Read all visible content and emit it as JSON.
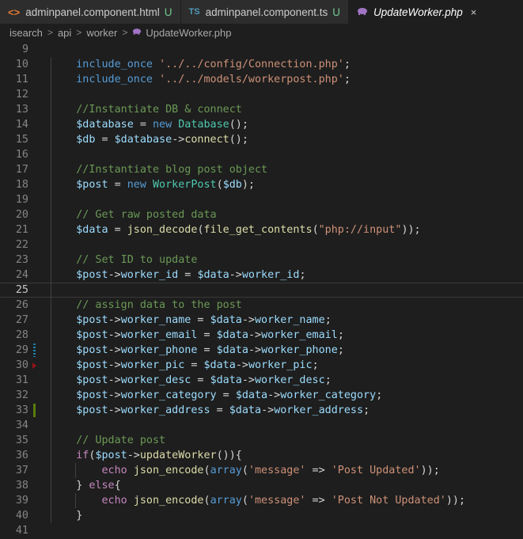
{
  "tabs": [
    {
      "icon": "<>",
      "label": "adminpanel.component.html",
      "badge": "U",
      "active": false
    },
    {
      "icon": "TS",
      "label": "adminpanel.component.ts",
      "badge": "U",
      "active": false
    },
    {
      "icon": "php",
      "label": "UpdateWorker.php",
      "close": "×",
      "active": true
    }
  ],
  "breadcrumb": {
    "items": [
      "isearch",
      "api",
      "worker",
      "UpdateWorker.php"
    ],
    "separator": ">"
  },
  "editor": {
    "current_line": 25,
    "lines": [
      {
        "n": "9",
        "tokens": []
      },
      {
        "n": "10",
        "tokens": [
          [
            "kw",
            "include_once"
          ],
          [
            "op",
            " "
          ],
          [
            "str",
            "'../../config/Connection.php'"
          ],
          [
            "op",
            ";"
          ]
        ]
      },
      {
        "n": "11",
        "tokens": [
          [
            "kw",
            "include_once"
          ],
          [
            "op",
            " "
          ],
          [
            "str",
            "'../../models/workerpost.php'"
          ],
          [
            "op",
            ";"
          ]
        ]
      },
      {
        "n": "12",
        "tokens": []
      },
      {
        "n": "13",
        "tokens": [
          [
            "cm",
            "//Instantiate DB & connect"
          ]
        ]
      },
      {
        "n": "14",
        "tokens": [
          [
            "var",
            "$database"
          ],
          [
            "op",
            " = "
          ],
          [
            "kw",
            "new"
          ],
          [
            "op",
            " "
          ],
          [
            "cls",
            "Database"
          ],
          [
            "op",
            "();"
          ]
        ]
      },
      {
        "n": "15",
        "tokens": [
          [
            "var",
            "$db"
          ],
          [
            "op",
            " = "
          ],
          [
            "var",
            "$database"
          ],
          [
            "op",
            "->"
          ],
          [
            "fn",
            "connect"
          ],
          [
            "op",
            "();"
          ]
        ]
      },
      {
        "n": "16",
        "tokens": []
      },
      {
        "n": "17",
        "tokens": [
          [
            "cm",
            "//Instantiate blog post object"
          ]
        ]
      },
      {
        "n": "18",
        "tokens": [
          [
            "var",
            "$post"
          ],
          [
            "op",
            " = "
          ],
          [
            "kw",
            "new"
          ],
          [
            "op",
            " "
          ],
          [
            "cls",
            "WorkerPost"
          ],
          [
            "op",
            "("
          ],
          [
            "var",
            "$db"
          ],
          [
            "op",
            ");"
          ]
        ]
      },
      {
        "n": "19",
        "tokens": []
      },
      {
        "n": "20",
        "tokens": [
          [
            "cm",
            "// Get raw posted data"
          ]
        ]
      },
      {
        "n": "21",
        "tokens": [
          [
            "var",
            "$data"
          ],
          [
            "op",
            " = "
          ],
          [
            "fn",
            "json_decode"
          ],
          [
            "op",
            "("
          ],
          [
            "fn",
            "file_get_contents"
          ],
          [
            "op",
            "("
          ],
          [
            "str",
            "\"php://input\""
          ],
          [
            "op",
            "));"
          ]
        ]
      },
      {
        "n": "22",
        "tokens": []
      },
      {
        "n": "23",
        "tokens": [
          [
            "cm",
            "// Set ID to update"
          ]
        ]
      },
      {
        "n": "24",
        "tokens": [
          [
            "var",
            "$post"
          ],
          [
            "op",
            "->"
          ],
          [
            "var",
            "worker_id"
          ],
          [
            "op",
            " = "
          ],
          [
            "var",
            "$data"
          ],
          [
            "op",
            "->"
          ],
          [
            "var",
            "worker_id"
          ],
          [
            "op",
            ";"
          ]
        ]
      },
      {
        "n": "25",
        "tokens": []
      },
      {
        "n": "26",
        "tokens": [
          [
            "cm",
            "// assign data to the post"
          ]
        ]
      },
      {
        "n": "27",
        "tokens": [
          [
            "var",
            "$post"
          ],
          [
            "op",
            "->"
          ],
          [
            "var",
            "worker_name"
          ],
          [
            "op",
            " = "
          ],
          [
            "var",
            "$data"
          ],
          [
            "op",
            "->"
          ],
          [
            "var",
            "worker_name"
          ],
          [
            "op",
            ";"
          ]
        ]
      },
      {
        "n": "28",
        "tokens": [
          [
            "var",
            "$post"
          ],
          [
            "op",
            "->"
          ],
          [
            "var",
            "worker_email"
          ],
          [
            "op",
            " = "
          ],
          [
            "var",
            "$data"
          ],
          [
            "op",
            "->"
          ],
          [
            "var",
            "worker_email"
          ],
          [
            "op",
            ";"
          ]
        ]
      },
      {
        "n": "29",
        "tokens": [
          [
            "var",
            "$post"
          ],
          [
            "op",
            "->"
          ],
          [
            "var",
            "worker_phone"
          ],
          [
            "op",
            " = "
          ],
          [
            "var",
            "$data"
          ],
          [
            "op",
            "->"
          ],
          [
            "var",
            "worker_phone"
          ],
          [
            "op",
            ";"
          ]
        ]
      },
      {
        "n": "30",
        "tokens": [
          [
            "var",
            "$post"
          ],
          [
            "op",
            "->"
          ],
          [
            "var",
            "worker_pic"
          ],
          [
            "op",
            " = "
          ],
          [
            "var",
            "$data"
          ],
          [
            "op",
            "->"
          ],
          [
            "var",
            "worker_pic"
          ],
          [
            "op",
            ";"
          ]
        ]
      },
      {
        "n": "31",
        "tokens": [
          [
            "var",
            "$post"
          ],
          [
            "op",
            "->"
          ],
          [
            "var",
            "worker_desc"
          ],
          [
            "op",
            " = "
          ],
          [
            "var",
            "$data"
          ],
          [
            "op",
            "->"
          ],
          [
            "var",
            "worker_desc"
          ],
          [
            "op",
            ";"
          ]
        ]
      },
      {
        "n": "32",
        "tokens": [
          [
            "var",
            "$post"
          ],
          [
            "op",
            "->"
          ],
          [
            "var",
            "worker_category"
          ],
          [
            "op",
            " = "
          ],
          [
            "var",
            "$data"
          ],
          [
            "op",
            "->"
          ],
          [
            "var",
            "worker_category"
          ],
          [
            "op",
            ";"
          ]
        ]
      },
      {
        "n": "33",
        "tokens": [
          [
            "var",
            "$post"
          ],
          [
            "op",
            "->"
          ],
          [
            "var",
            "worker_address"
          ],
          [
            "op",
            " = "
          ],
          [
            "var",
            "$data"
          ],
          [
            "op",
            "->"
          ],
          [
            "var",
            "worker_address"
          ],
          [
            "op",
            ";"
          ]
        ]
      },
      {
        "n": "34",
        "tokens": []
      },
      {
        "n": "35",
        "tokens": [
          [
            "cm",
            "// Update post"
          ]
        ]
      },
      {
        "n": "36",
        "tokens": [
          [
            "ctl",
            "if"
          ],
          [
            "op",
            "("
          ],
          [
            "var",
            "$post"
          ],
          [
            "op",
            "->"
          ],
          [
            "fn",
            "updateWorker"
          ],
          [
            "op",
            "()){"
          ]
        ]
      },
      {
        "n": "37",
        "tokens": [
          [
            "op",
            "    "
          ],
          [
            "ctl",
            "echo"
          ],
          [
            "op",
            " "
          ],
          [
            "fn",
            "json_encode"
          ],
          [
            "op",
            "("
          ],
          [
            "kw",
            "array"
          ],
          [
            "op",
            "("
          ],
          [
            "str",
            "'message'"
          ],
          [
            "op",
            " => "
          ],
          [
            "str",
            "'Post Updated'"
          ],
          [
            "op",
            "));"
          ]
        ]
      },
      {
        "n": "38",
        "tokens": [
          [
            "op",
            "} "
          ],
          [
            "ctl",
            "else"
          ],
          [
            "op",
            "{"
          ]
        ]
      },
      {
        "n": "39",
        "tokens": [
          [
            "op",
            "    "
          ],
          [
            "ctl",
            "echo"
          ],
          [
            "op",
            " "
          ],
          [
            "fn",
            "json_encode"
          ],
          [
            "op",
            "("
          ],
          [
            "kw",
            "array"
          ],
          [
            "op",
            "("
          ],
          [
            "str",
            "'message'"
          ],
          [
            "op",
            " => "
          ],
          [
            "str",
            "'Post Not Updated'"
          ],
          [
            "op",
            "));"
          ]
        ]
      },
      {
        "n": "40",
        "tokens": [
          [
            "op",
            "}"
          ]
        ]
      },
      {
        "n": "41",
        "tokens": []
      }
    ],
    "gutter_marks": {
      "29": "mod",
      "30": "del",
      "33": "add"
    },
    "indent_guides": [
      "10",
      "11",
      "12",
      "13",
      "14",
      "15",
      "16",
      "17",
      "18",
      "19",
      "20",
      "21",
      "22",
      "23",
      "24",
      "25",
      "26",
      "27",
      "28",
      "29",
      "30",
      "31",
      "32",
      "33",
      "34",
      "35",
      "36",
      "37",
      "38",
      "39",
      "40"
    ],
    "inner_guides": [
      "37",
      "39"
    ],
    "code_indent": "    "
  }
}
